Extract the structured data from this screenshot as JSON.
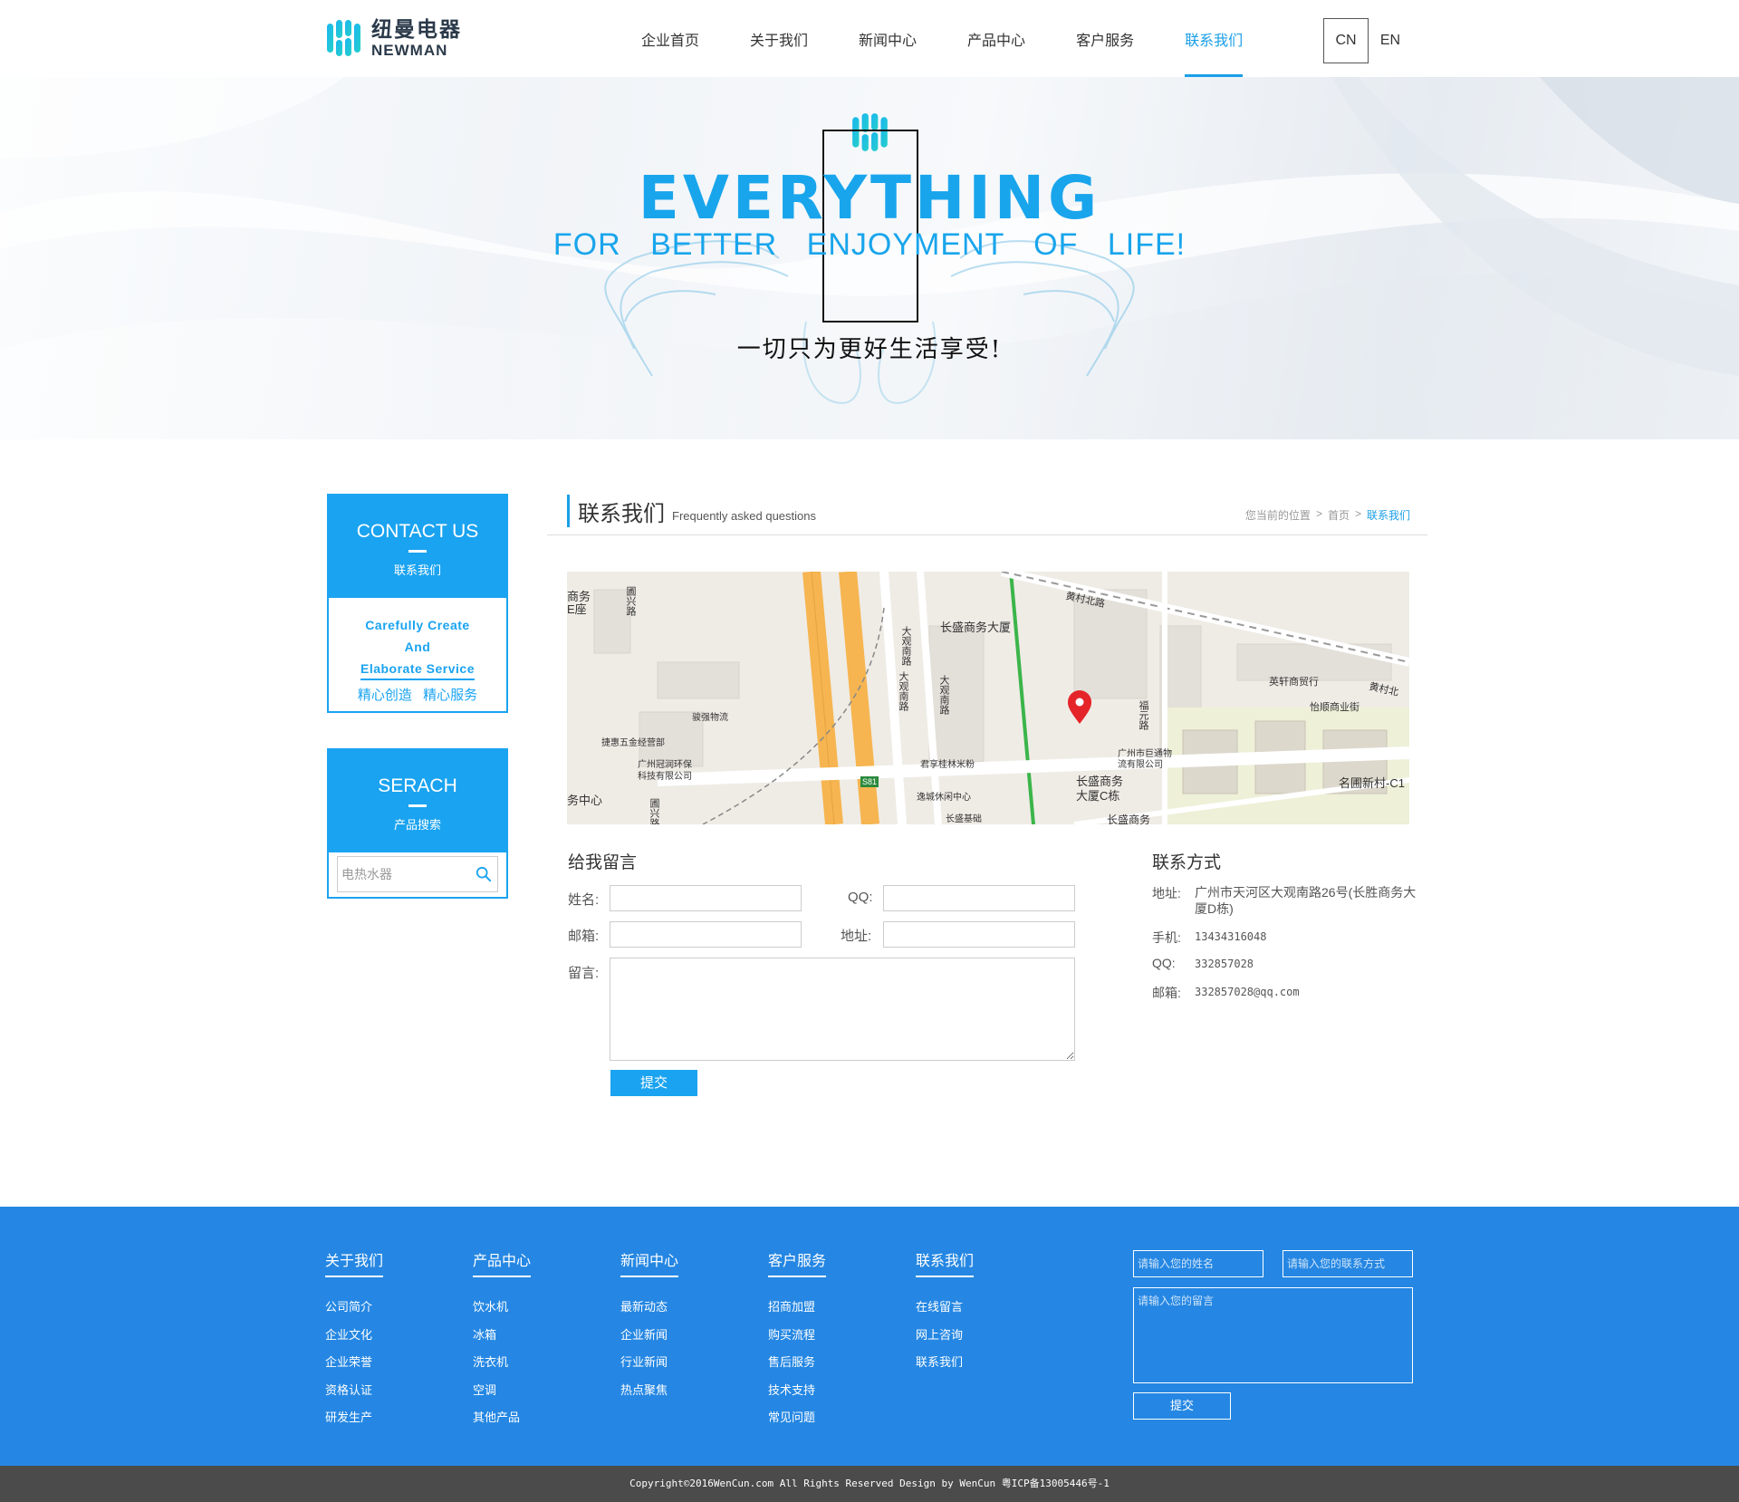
{
  "header": {
    "logo_cn": "纽曼电器",
    "logo_en": "NEWMAN",
    "nav": [
      "企业首页",
      "关于我们",
      "新闻中心",
      "产品中心",
      "客户服务",
      "联系我们"
    ],
    "nav_active_index": 5,
    "lang_cn": "CN",
    "lang_en": "EN"
  },
  "banner": {
    "headline": "EVERYTHING",
    "subline": "FOR BETTER ENJOYMENT OF LIFE!",
    "slogan_cn": "一切只为更好生活享受!"
  },
  "sidebar": {
    "contact": {
      "title_en": "CONTACT US",
      "title_cn": "联系我们",
      "line1": "Carefully Create",
      "line2": "And",
      "line3": "Elaborate Service",
      "cn": "精心创造 精心服务"
    },
    "search": {
      "title_en": "SERACH",
      "title_cn": "产品搜索",
      "placeholder": "电热水器"
    }
  },
  "main": {
    "title_cn": "联系我们",
    "title_en": "Frequently asked questions",
    "breadcrumb": {
      "prefix": "您当前的位置",
      "home": "首页",
      "current": "联系我们"
    },
    "map_labels": {
      "l1": "长盛商务大厦",
      "l2": "黄村北路",
      "l3": "英轩商贸行",
      "l4": "怡顺商业街",
      "l5": "黄村北",
      "l6": "大观南路",
      "l7": "骏强物流",
      "l8": "捷惠五金经营部",
      "l9": "广州冠润环保",
      "l10": "科技有限公司",
      "l11": "君享桂林米粉",
      "l12": "逸城休闲中心",
      "l13": "长盛基础",
      "l14": "广州市巨通物",
      "l15": "流有限公司",
      "l16": "长盛商务",
      "l17": "大厦C栋",
      "l18": "名圃新村-C1",
      "l19": "福元路",
      "l20": "圃兴路",
      "l21": "务中心",
      "l22": "S81",
      "l23": "长盛商务",
      "l24": "商务",
      "l25": "E座"
    },
    "form": {
      "title": "给我留言",
      "name_label": "姓名:",
      "qq_label": "QQ:",
      "email_label": "邮箱:",
      "address_label": "地址:",
      "message_label": "留言:",
      "submit": "提交"
    },
    "contact_info": {
      "title": "联系方式",
      "address_label": "地址:",
      "address": "广州市天河区大观南路26号(长胜商务大厦D栋)",
      "phone_label": "手机:",
      "phone": "13434316048",
      "qq_label": "QQ:",
      "qq": "332857028",
      "email_label": "邮箱:",
      "email": "332857028@qq.com"
    }
  },
  "footer": {
    "columns": [
      {
        "title": "关于我们",
        "items": [
          "公司简介",
          "企业文化",
          "企业荣誉",
          "资格认证",
          "研发生产"
        ]
      },
      {
        "title": "产品中心",
        "items": [
          "饮水机",
          "冰箱",
          "洗衣机",
          "空调",
          "其他产品"
        ]
      },
      {
        "title": "新闻中心",
        "items": [
          "最新动态",
          "企业新闻",
          "行业新闻",
          "热点聚焦"
        ]
      },
      {
        "title": "客户服务",
        "items": [
          "招商加盟",
          "购买流程",
          "售后服务",
          "技术支持",
          "常见问题"
        ]
      },
      {
        "title": "联系我们",
        "items": [
          "在线留言",
          "网上咨询",
          "联系我们"
        ]
      }
    ],
    "name_placeholder": "请输入您的姓名",
    "contact_placeholder": "请输入您的联系方式",
    "message_placeholder": "请输入您的留言",
    "submit": "提交",
    "copyright": "Copyright©2016WenCun.com All Rights Reserved Design by WenCun 粤ICP备13005446号-1"
  },
  "colors": {
    "accent": "#1aa3f0",
    "footer_bg": "#2587e3",
    "copyright_bg": "#4b4b4b"
  }
}
